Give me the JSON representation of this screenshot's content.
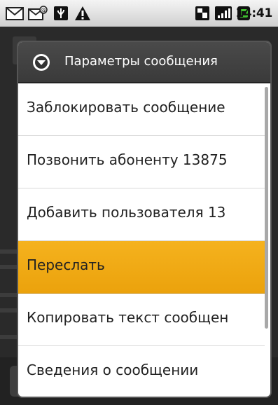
{
  "status_bar": {
    "time": "14:41",
    "icons": [
      "gmail-icon",
      "email-icon",
      "usb-icon",
      "warning-icon",
      "sim-icon",
      "signal-icon",
      "battery-icon"
    ]
  },
  "dialog": {
    "title": "Параметры сообщения",
    "items": [
      {
        "label": "Заблокировать сообщение",
        "selected": false
      },
      {
        "label": "Позвонить абоненту 13875",
        "selected": false
      },
      {
        "label": "Добавить пользователя 13",
        "selected": false
      },
      {
        "label": "Переслать",
        "selected": true
      },
      {
        "label": "Копировать текст сообщен",
        "selected": false
      },
      {
        "label": "Сведения о сообщении",
        "selected": false
      }
    ]
  },
  "colors": {
    "highlight": "#f0a818",
    "header_bg": "#414141",
    "dialog_bg": "#ffffff"
  }
}
